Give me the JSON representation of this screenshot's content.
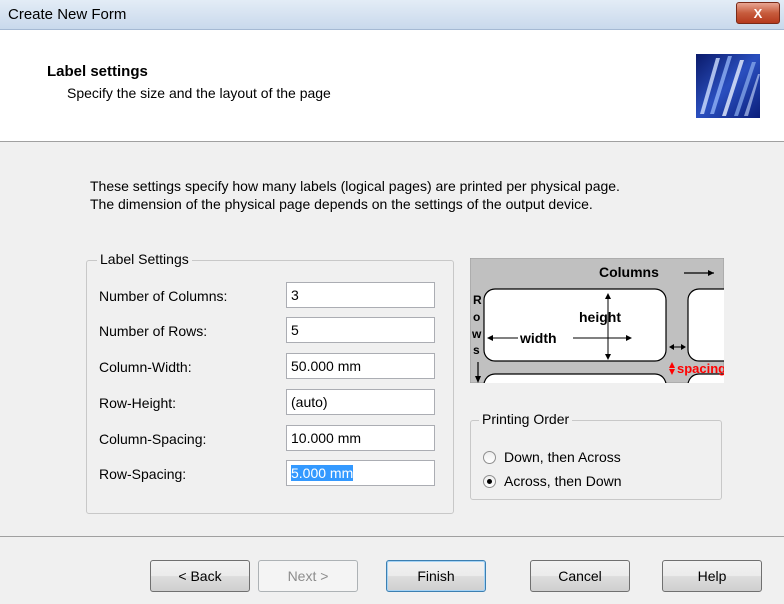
{
  "window": {
    "title": "Create New Form",
    "close_label": "X"
  },
  "header": {
    "title": "Label settings",
    "subtitle": "Specify the size and the layout of the page"
  },
  "intro": {
    "line1": "These settings specify how many labels (logical pages) are printed per physical page.",
    "line2": "The dimension of the physical page depends on the settings of the output device."
  },
  "label_settings": {
    "group_title": "Label Settings",
    "fields": [
      {
        "label": "Number of Columns:",
        "value": "3"
      },
      {
        "label": "Number of Rows:",
        "value": "5"
      },
      {
        "label": "Column-Width:",
        "value": "50.000 mm"
      },
      {
        "label": "Row-Height:",
        "value": "(auto)"
      },
      {
        "label": "Column-Spacing:",
        "value": "10.000 mm"
      },
      {
        "label": "Row-Spacing:",
        "value": "5.000 mm"
      }
    ]
  },
  "diagram": {
    "columns": "Columns",
    "rows_letters": [
      "R",
      "o",
      "w",
      "s"
    ],
    "height": "height",
    "width": "width",
    "spacing": "spacing",
    "colors": {
      "background": "#c0c0c0",
      "spacing_text": "#ff0000"
    }
  },
  "printing_order": {
    "group_title": "Printing Order",
    "options": [
      {
        "label": "Down, then Across",
        "checked": false
      },
      {
        "label": "Across, then Down",
        "checked": true
      }
    ]
  },
  "buttons": {
    "back": "< Back",
    "next": "Next >",
    "finish": "Finish",
    "cancel": "Cancel",
    "help": "Help"
  }
}
